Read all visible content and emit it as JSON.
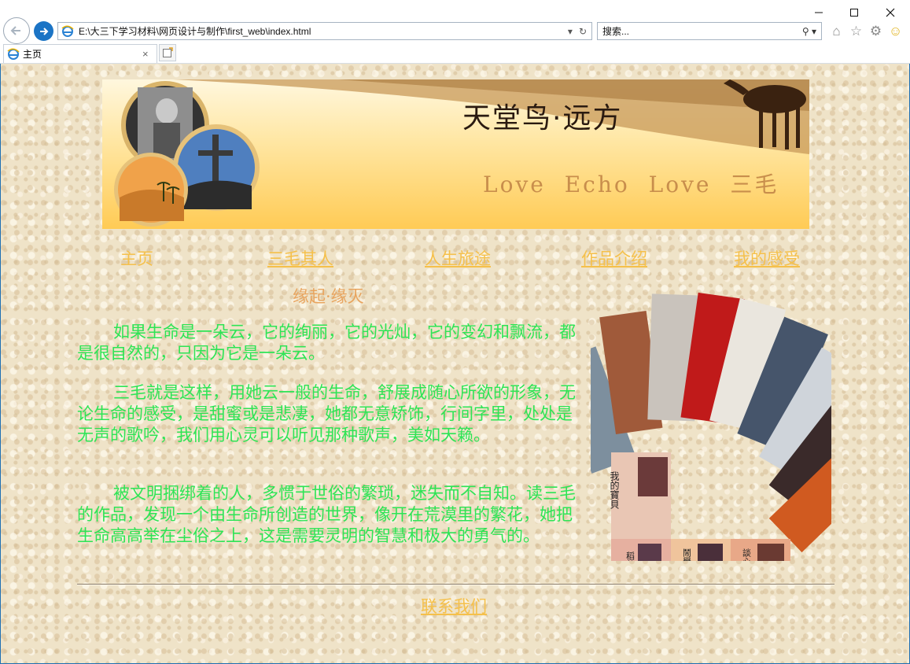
{
  "window": {
    "minimize": "—",
    "maximize": "☐",
    "close": "✕"
  },
  "toolbar": {
    "back_icon": "back-arrow-icon",
    "forward_icon": "forward-arrow-icon",
    "address": "E:\\大三下学习材料\\网页设计与制作\\first_web\\index.html",
    "search_placeholder": "搜索...",
    "right_icons": [
      "home-icon",
      "favorites-star-icon",
      "settings-gear-icon",
      "smiley-feedback-icon"
    ]
  },
  "tabs": [
    {
      "label": "主页",
      "icon": "ie-page-icon"
    }
  ],
  "page": {
    "banner": {
      "title": "天堂鸟·远方",
      "subtitle": "Love Echo  Love 三毛"
    },
    "nav": [
      {
        "label": "主页",
        "underlined": false
      },
      {
        "label": "三毛其人",
        "underlined": true
      },
      {
        "label": "人生旅途",
        "underlined": true
      },
      {
        "label": "作品介绍",
        "underlined": true
      },
      {
        "label": "我的感受",
        "underlined": true
      }
    ],
    "section_title": "缘起·缘灭",
    "paragraphs": [
      "如果生命是一朵云，它的绚丽，它的光灿，它的变幻和飘流，都是很自然的，只因为它是一朵云。",
      "三毛就是这样，用她云一般的生命，舒展成随心所欲的形象，无论生命的感受，是甜蜜或是悲凄，她都无意矫饰，行间字里，处处是无声的歌吟，我们用心灵可以听见那种歌声，美如天籁。",
      "被文明捆绑着的人，多惯于世俗的繁琐，迷失而不自知。读三毛的作品，发现一个由生命所创造的世界，像开在荒漠里的繁花，她把生命高高举在尘俗之上，这是需要灵明的智慧和极大的勇气的。"
    ],
    "book_titles": [
      "我的寶貝",
      "稻草人手記",
      "鬧學記",
      "談心"
    ],
    "footer_link": "联系我们"
  },
  "colors": {
    "nav_link": "#f5c04b",
    "section_title": "#e8a45e",
    "body_text": "#2ee455",
    "page_bg": "#efe3c8",
    "ie_blue": "#1b74c5"
  }
}
